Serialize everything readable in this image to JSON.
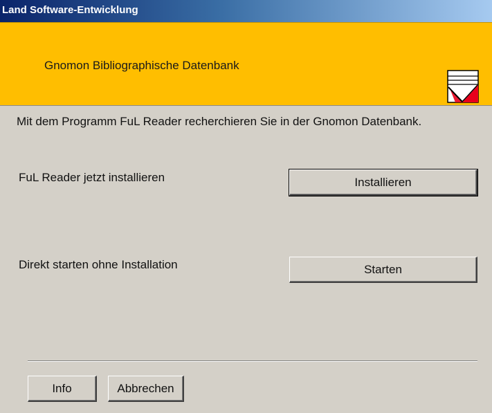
{
  "window": {
    "title": "Land Software-Entwicklung"
  },
  "banner": {
    "title": "Gnomon Bibliographische Datenbank",
    "logo_icon": "gnomon-logo-icon"
  },
  "intro_text": "Mit dem Programm FuL Reader recherchieren Sie in der Gnomon Datenbank.",
  "install": {
    "label": "FuL Reader jetzt installieren",
    "button": "Installieren"
  },
  "start": {
    "label": "Direkt starten ohne Installation",
    "button": "Starten"
  },
  "footer": {
    "info_button": "Info",
    "cancel_button": "Abbrechen"
  },
  "colors": {
    "banner": "#ffbe00",
    "dialog": "#d4d0c8",
    "titlebar": "#0a246a",
    "logo_red": "#e8001c"
  }
}
